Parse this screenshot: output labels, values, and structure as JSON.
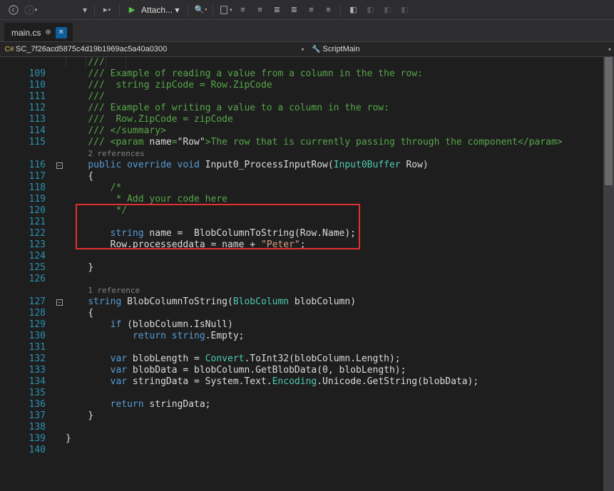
{
  "toolbar": {
    "attach_label": "Attach...",
    "icons": [
      "nav-back",
      "nav-fwd",
      "dropdown",
      "sep",
      "playback",
      "sep",
      "play",
      "attach",
      "sep",
      "magnifier",
      "sep",
      "doc-icon",
      "tree-icon",
      "indent-icon",
      "list-icon",
      "comment-icon",
      "uncomment-icon",
      "sep",
      "bookmark-add",
      "bookmark-prev",
      "bookmark-next",
      "bookmark-clear"
    ]
  },
  "tab": {
    "name": "main.cs"
  },
  "navbar": {
    "left_icon": "csharp-icon",
    "left_text": "SC_7f26acd5875c4d19b1969ac5a40a0300",
    "right_icon": "class-icon",
    "right_text": "ScriptMain"
  },
  "code": {
    "lines": [
      {
        "n": "",
        "t": "///"
      },
      {
        "n": "109",
        "t": "/// Example of reading a value from a column in the the row:"
      },
      {
        "n": "110",
        "t": "///  string zipCode = Row.ZipCode"
      },
      {
        "n": "111",
        "t": "///"
      },
      {
        "n": "112",
        "t": "/// Example of writing a value to a column in the row:"
      },
      {
        "n": "113",
        "t": "///  Row.ZipCode = zipCode"
      },
      {
        "n": "114",
        "t": "/// </summary>"
      },
      {
        "n": "115",
        "t": "/// <param name=\"Row\">The row that is currently passing through the component</param>"
      },
      {
        "n": "",
        "ref": "2 references"
      },
      {
        "n": "116",
        "fold": "-",
        "kw": "public override void",
        "m": " Input0_ProcessInputRow(",
        "ty": "Input0Buffer",
        "a": " Row)"
      },
      {
        "n": "117",
        "t": "{"
      },
      {
        "n": "118",
        "c": "    /*"
      },
      {
        "n": "119",
        "c": "     * Add your code here"
      },
      {
        "n": "120",
        "c": "     */"
      },
      {
        "n": "121",
        "t": ""
      },
      {
        "n": "122",
        "stmt": "    string name =  BlobColumnToString(Row.Name);"
      },
      {
        "n": "123",
        "stmt2": "    Row.processeddata = name + \"Peter\";"
      },
      {
        "n": "124",
        "t": ""
      },
      {
        "n": "125",
        "t": "}"
      },
      {
        "n": "126",
        "t": ""
      },
      {
        "n": "",
        "ref": "1 reference"
      },
      {
        "n": "127",
        "fold": "-",
        "kw": "string",
        "m": " BlobColumnToString(",
        "ty": "BlobColumn",
        "a": " blobColumn)"
      },
      {
        "n": "128",
        "t": "{"
      },
      {
        "n": "129",
        "if": "    if (blobColumn.IsNull)"
      },
      {
        "n": "130",
        "ret1": "        return string.Empty;"
      },
      {
        "n": "131",
        "t": ""
      },
      {
        "n": "132",
        "v1": "    var blobLength = Convert.ToInt32(blobColumn.Length);"
      },
      {
        "n": "133",
        "v2": "    var blobData = blobColumn.GetBlobData(0, blobLength);"
      },
      {
        "n": "134",
        "v3": "    var stringData = System.Text.Encoding.Unicode.GetString(blobData);"
      },
      {
        "n": "135",
        "t": ""
      },
      {
        "n": "136",
        "ret2": "    return stringData;"
      },
      {
        "n": "137",
        "t": "}"
      },
      {
        "n": "138",
        "t": ""
      },
      {
        "n": "139",
        "close": "}"
      },
      {
        "n": "140",
        "t": ""
      }
    ]
  }
}
